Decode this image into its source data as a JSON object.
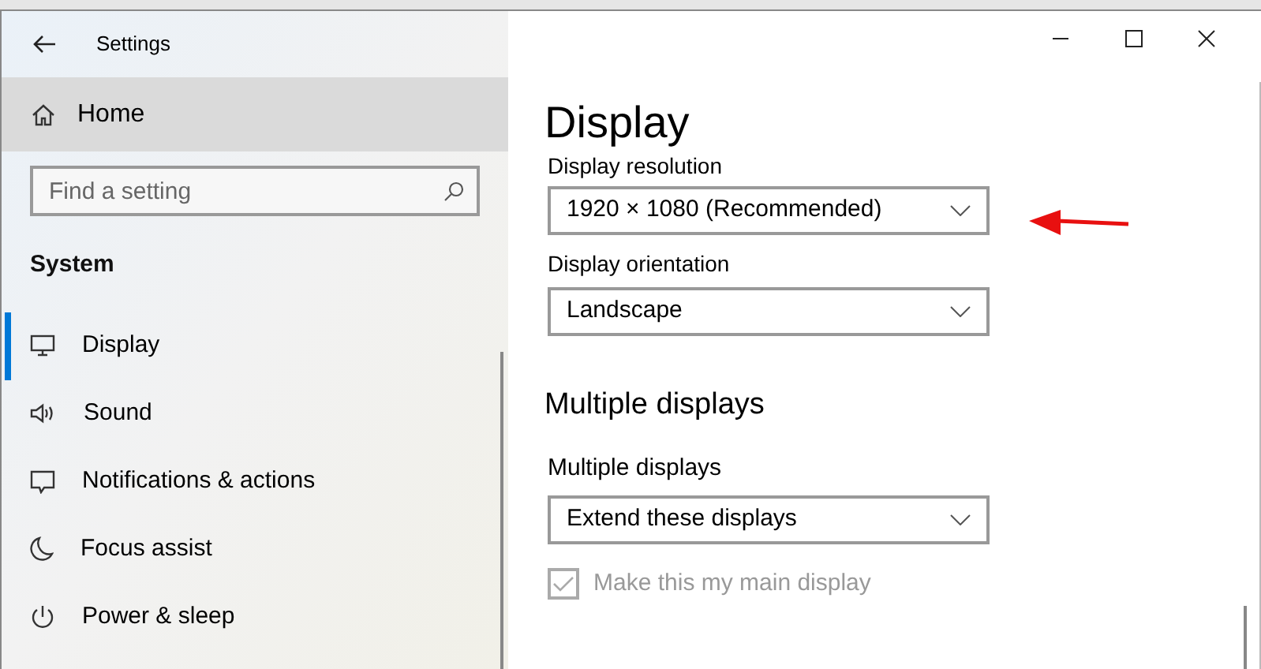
{
  "window": {
    "title": "Settings"
  },
  "sidebar": {
    "home": {
      "label": "Home",
      "selected": false
    },
    "search": {
      "placeholder": "Find a setting"
    },
    "section": "System",
    "items": [
      {
        "label": "Display",
        "selected": true
      },
      {
        "label": "Sound",
        "selected": false
      },
      {
        "label": "Notifications & actions",
        "selected": false
      },
      {
        "label": "Focus assist",
        "selected": false
      },
      {
        "label": "Power & sleep",
        "selected": false
      }
    ]
  },
  "main": {
    "title": "Display",
    "fields": [
      {
        "label": "Display resolution",
        "value": "1920 × 1080 (Recommended)"
      },
      {
        "label": "Display orientation",
        "value": "Landscape"
      }
    ],
    "section": {
      "heading": "Multiple displays",
      "field": {
        "label": "Multiple displays",
        "value": "Extend these displays"
      },
      "checkbox": {
        "label": "Make this my main display",
        "checked": true,
        "disabled": true
      }
    }
  }
}
